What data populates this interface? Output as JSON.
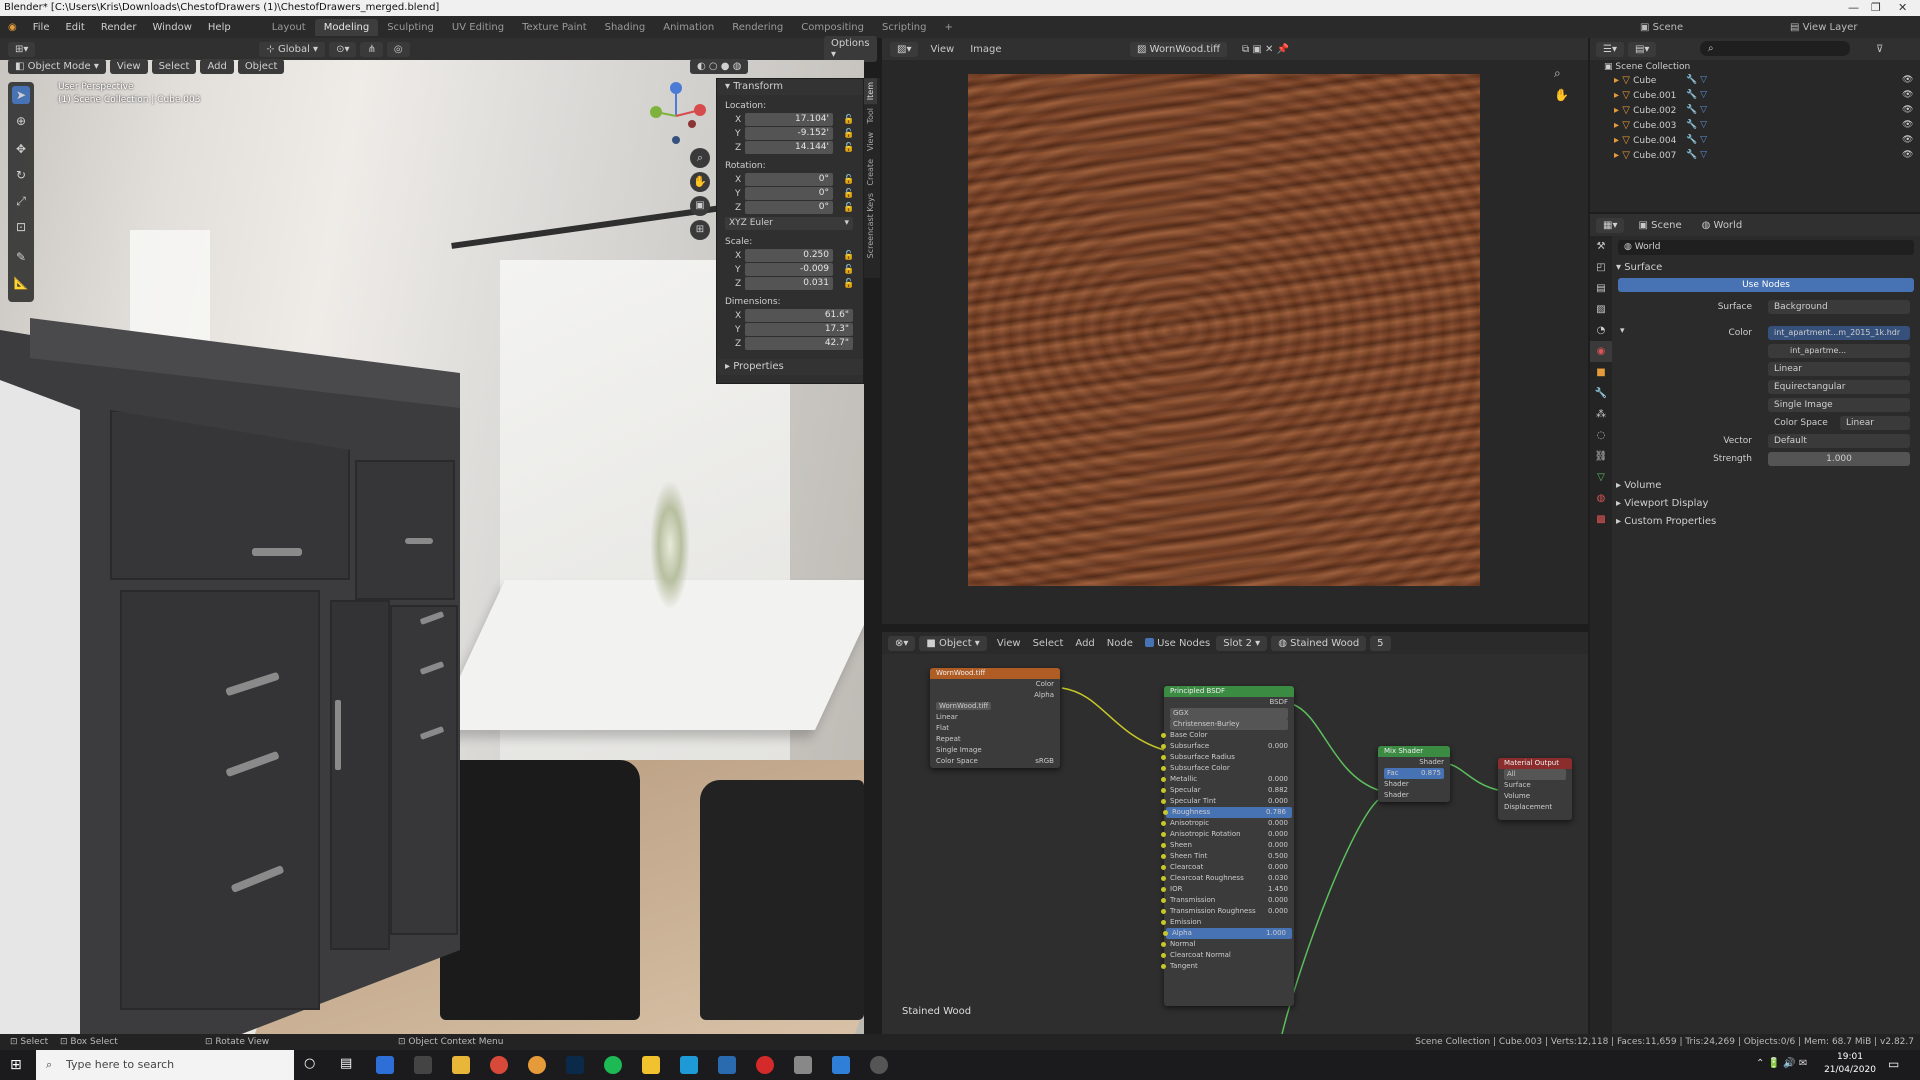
{
  "window": {
    "title": "Blender* [C:\\Users\\Kris\\Downloads\\ChestofDrawers (1)\\ChestofDrawers_merged.blend]"
  },
  "menu": [
    "File",
    "Edit",
    "Render",
    "Window",
    "Help"
  ],
  "workspaces": [
    "Layout",
    "Modeling",
    "Sculpting",
    "UV Editing",
    "Texture Paint",
    "Shading",
    "Animation",
    "Rendering",
    "Compositing",
    "Scripting"
  ],
  "active_workspace": "Modeling",
  "scene_name": "Scene",
  "view_layer": "View Layer",
  "viewport": {
    "mode": "Object Mode",
    "menu": [
      "View",
      "Select",
      "Add",
      "Object"
    ],
    "orientation": "Global",
    "options": "Options",
    "overlay_title": "User Perspective",
    "overlay_sub": "(1) Scene Collection | Cube.003"
  },
  "transform": {
    "header": "Transform",
    "location_label": "Location:",
    "location": {
      "x": "17.104'",
      "y": "-9.152'",
      "z": "14.144'"
    },
    "rotation_label": "Rotation:",
    "rotation": {
      "x": "0°",
      "y": "0°",
      "z": "0°"
    },
    "euler": "XYZ Euler",
    "scale_label": "Scale:",
    "scale": {
      "x": "0.250",
      "y": "-0.009",
      "z": "0.031"
    },
    "dimensions_label": "Dimensions:",
    "dimensions": {
      "x": "61.6\"",
      "y": "17.3\"",
      "z": "42.7\""
    },
    "properties": "Properties",
    "axis": {
      "x": "X",
      "y": "Y",
      "z": "Z"
    }
  },
  "side_tabs": [
    "Item",
    "Tool",
    "View",
    "Create",
    "Screencast Keys"
  ],
  "image_editor": {
    "menu": [
      "View",
      "Image"
    ],
    "image_name": "WornWood.tiff"
  },
  "node_editor": {
    "object": "Object",
    "menu": [
      "View",
      "Select",
      "Add",
      "Node"
    ],
    "use_nodes": "Use Nodes",
    "slot": "Slot 2",
    "material": "Stained Wood",
    "users": "5",
    "footer_label": "Stained Wood",
    "tex_node": {
      "title": "WornWood.tiff",
      "outputs": [
        "Color",
        "Alpha"
      ],
      "image": "WornWood.tiff",
      "rows": [
        "Linear",
        "Flat",
        "Repeat",
        "Single Image"
      ],
      "colorspace_label": "Color Space",
      "colorspace": "sRGB",
      "input": "Vector"
    },
    "bsdf": {
      "title": "Principled BSDF",
      "out": "BSDF",
      "dist": "GGX",
      "sss": "Christensen-Burley",
      "rows": [
        {
          "n": "Base Color",
          "v": ""
        },
        {
          "n": "Subsurface",
          "v": "0.000"
        },
        {
          "n": "Subsurface Radius",
          "v": ""
        },
        {
          "n": "Subsurface Color",
          "v": ""
        },
        {
          "n": "Metallic",
          "v": "0.000"
        },
        {
          "n": "Specular",
          "v": "0.882"
        },
        {
          "n": "Specular Tint",
          "v": "0.000"
        },
        {
          "n": "Roughness",
          "v": "0.786"
        },
        {
          "n": "Anisotropic",
          "v": "0.000"
        },
        {
          "n": "Anisotropic Rotation",
          "v": "0.000"
        },
        {
          "n": "Sheen",
          "v": "0.000"
        },
        {
          "n": "Sheen Tint",
          "v": "0.500"
        },
        {
          "n": "Clearcoat",
          "v": "0.000"
        },
        {
          "n": "Clearcoat Roughness",
          "v": "0.030"
        },
        {
          "n": "IOR",
          "v": "1.450"
        },
        {
          "n": "Transmission",
          "v": "0.000"
        },
        {
          "n": "Transmission Roughness",
          "v": "0.000"
        },
        {
          "n": "Emission",
          "v": ""
        },
        {
          "n": "Alpha",
          "v": "1.000"
        },
        {
          "n": "Normal",
          "v": ""
        },
        {
          "n": "Clearcoat Normal",
          "v": ""
        },
        {
          "n": "Tangent",
          "v": ""
        }
      ]
    },
    "mix": {
      "title": "Mix Shader",
      "out": "Shader",
      "fac_label": "Fac",
      "fac": "0.875",
      "in1": "Shader",
      "in2": "Shader"
    },
    "output": {
      "title": "Material Output",
      "target": "All",
      "rows": [
        "Surface",
        "Volume",
        "Displacement"
      ]
    }
  },
  "outliner": {
    "root": "Scene Collection",
    "items": [
      "Cube",
      "Cube.001",
      "Cube.002",
      "Cube.003",
      "Cube.004",
      "Cube.007"
    ]
  },
  "properties": {
    "tabs": [
      "Scene",
      "World"
    ],
    "world_name": "World",
    "surface_header": "Surface",
    "use_nodes": "Use Nodes",
    "surface_label": "Surface",
    "surface_value": "Background",
    "color_label": "Color",
    "color_value": "int_apartment...m_2015_1k.hdr",
    "image_name": "int_apartme...",
    "interp": "Linear",
    "projection": "Equirectangular",
    "source": "Single Image",
    "colorspace_label": "Color Space",
    "colorspace": "Linear",
    "vector_label": "Vector",
    "vector": "Default",
    "strength_label": "Strength",
    "strength": "1.000",
    "sections": [
      "Volume",
      "Viewport Display",
      "Custom Properties"
    ]
  },
  "statusbar": {
    "select": "Select",
    "box_select": "Box Select",
    "rotate": "Rotate View",
    "context": "Object Context Menu",
    "stats": "Scene Collection | Cube.003 | Verts:12,118 | Faces:11,659 | Tris:24,269 | Objects:0/6 | Mem: 68.7 MiB | v2.82.7"
  },
  "taskbar": {
    "search": "Type here to search",
    "time": "19:01",
    "date": "21/04/2020"
  }
}
